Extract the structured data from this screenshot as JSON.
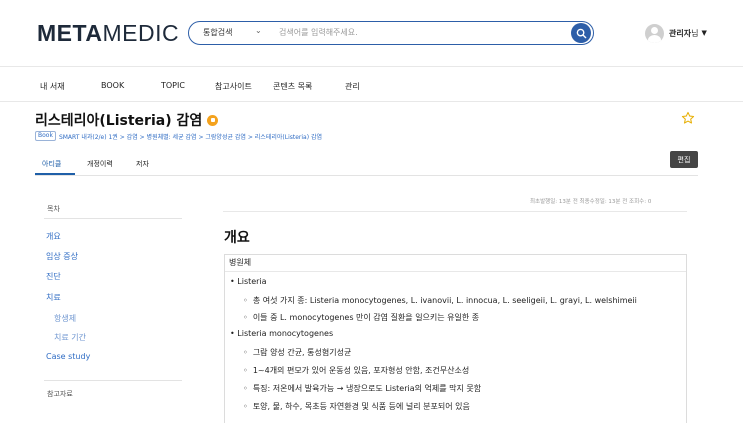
{
  "header": {
    "logo_bold": "META",
    "logo_light": "MEDIC",
    "search": {
      "scope": "통합검색",
      "placeholder": "검색어를 입력해주세요."
    },
    "user": {
      "name": "관리자",
      "suffix": "님"
    }
  },
  "nav": {
    "items": [
      "내 서재",
      "BOOK",
      "TOPIC",
      "참고사이트",
      "콘텐츠 목록",
      "관리"
    ]
  },
  "article": {
    "title": "리스테리아(Listeria) 감염",
    "breadcrumb_tag": "Book",
    "breadcrumb": "SMART 내과(2/e) 1권 > 감염 > 병원체별: 세균 감염 > 그람양성균 감염 > 리스테리아(Listeria) 감염"
  },
  "tabs": [
    "아티클",
    "개정이력",
    "저자"
  ],
  "edit_label": "편집",
  "toc": {
    "label": "목차",
    "items": [
      "개요",
      "임상 증상",
      "진단",
      "치료"
    ],
    "sub_items": [
      "항생제",
      "치료 기간"
    ],
    "case_study": "Case study",
    "references": "참고자료"
  },
  "meta": "최초발행일: 13분 전   최종수정일: 13분 전   조회수: 0",
  "content": {
    "heading": "개요",
    "box_title": "병원체",
    "bullets": [
      {
        "label": "Listeria",
        "subs": [
          "총 여섯 가지 종: Listeria monocytogenes, L. ivanovii, L. innocua, L. seeligeii, L. grayi, L. welshimeii",
          "이들 중 L. monocytogenes 만이 감염 질환을 일으키는 유일한 종"
        ]
      },
      {
        "label": "Listeria monocytogenes",
        "subs": [
          "그람 양성 간균, 통성혐기성균",
          "1~4개의 편모가 있어 운동성 있음, 포자형성 안함, 조건무산소성",
          "특징: 저온에서 발육가능 → 냉장으로도 Listeria의 억제를 막지 못함",
          "토양, 물, 하수, 목초등 자연환경 및 식품 등에 널리 분포되어 있음"
        ]
      }
    ]
  },
  "colors": {
    "primary": "#2d5ea8",
    "link": "#2f6cc4",
    "badge": "#f4a21d",
    "star": "#e8b007",
    "edit_button": "#454545"
  },
  "icons": {
    "search": "search-icon",
    "star": "star-icon",
    "avatar": "user-avatar-icon"
  }
}
